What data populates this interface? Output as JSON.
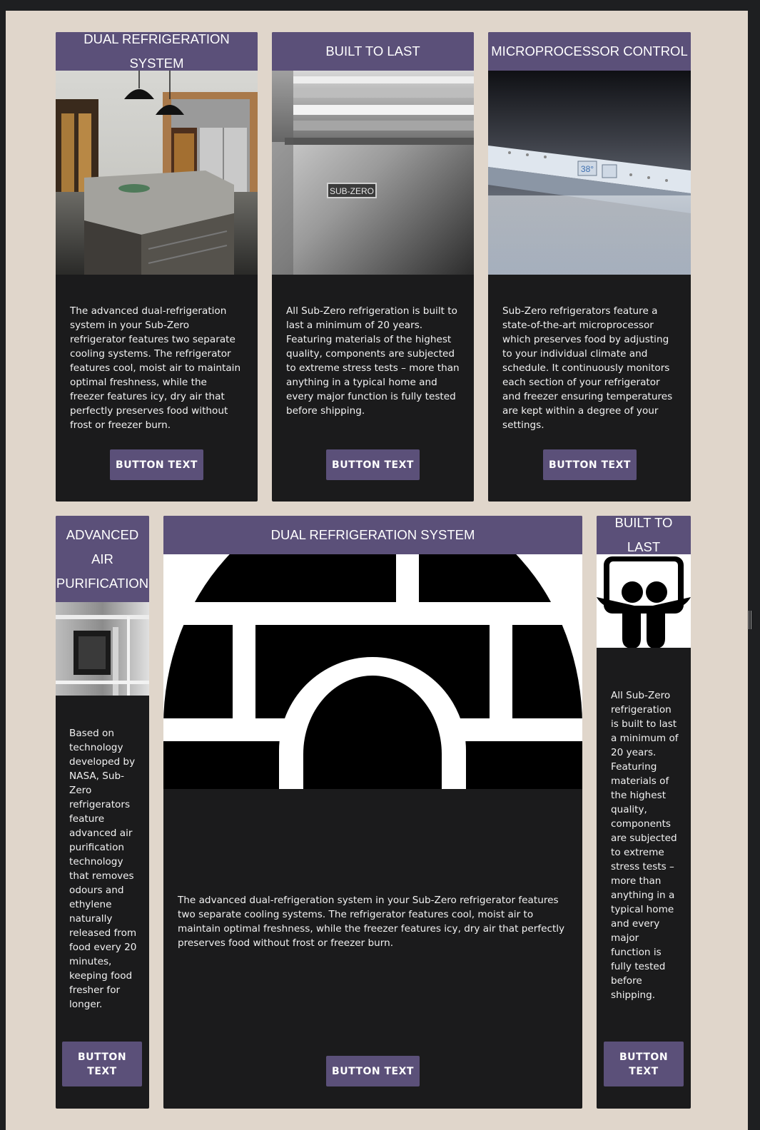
{
  "colors": {
    "accent": "#5b5079",
    "card_bg": "#1b1b1c",
    "page_bg": "#e0d6cb"
  },
  "cards": [
    {
      "title": "DUAL REFRIGERATION SYSTEM",
      "image": "kitchen-photo",
      "text": "The advanced dual-refrigeration system in your Sub-Zero refrigerator features two separate cooling systems. The refrigerator features cool, moist air to maintain optimal freshness, while the freezer features icy, dry air that perfectly preserves food without frost or freezer burn.",
      "button": "BUTTON TEXT"
    },
    {
      "title": "BUILT TO LAST",
      "image": "refrigerator-door-photo",
      "image_text": "SUB-ZERO",
      "text": "All Sub-Zero refrigeration is built to last a minimum of 20 years. Featuring materials of the highest quality, components are subjected to extreme stress tests – more than anything in a typical home and every major function is fully tested before shipping.",
      "button": "BUTTON TEXT"
    },
    {
      "title": "MICROPROCESSOR CONTROL",
      "image": "control-panel-photo",
      "image_text": "38°",
      "text": "Sub-Zero refrigerators feature a state-of-the-art microprocessor which preserves food by adjusting to your individual climate and schedule. It continuously monitors each section of your refrigerator and freezer ensuring temperatures are kept within a degree of your settings.",
      "button": "BUTTON TEXT"
    },
    {
      "title": "ADVANCED AIR PURIFICATION",
      "image": "air-purifier-photo",
      "text": "Based on technology developed by NASA, Sub-Zero refrigerators feature advanced air purification technology that removes odours and ethylene naturally released from food every 20 minutes, keeping food fresher for longer.",
      "button": "BUTTON TEXT"
    },
    {
      "title": "DUAL REFRIGERATION SYSTEM",
      "image": "igloo-icon",
      "text": "The advanced dual-refrigeration system in your Sub-Zero refrigerator features two separate cooling systems. The refrigerator features cool, moist air to maintain optimal freshness, while the freezer features icy, dry air that perfectly preserves food without frost or freezer burn.",
      "button": "BUTTON TEXT"
    },
    {
      "title": "BUILT TO LAST",
      "image": "slideshare-icon",
      "text": "All Sub-Zero refrigeration is built to last a minimum of 20 years. Featuring materials of the highest quality, components are subjected to extreme stress tests – more than anything in a typical home and every major function is fully tested before shipping.",
      "button": "BUTTON TEXT"
    }
  ]
}
